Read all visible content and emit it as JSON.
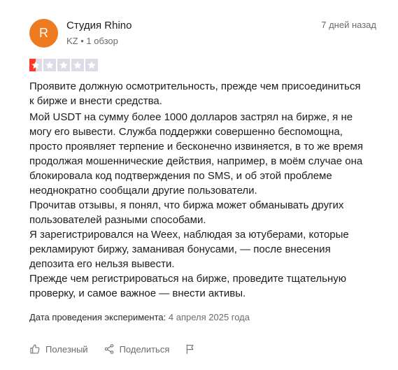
{
  "review": {
    "avatar_letter": "R",
    "avatar_color": "#ef7b20",
    "author_name": "Студия Rhino",
    "author_meta": "KZ • 1 обзор",
    "date": "7 дней назад",
    "rating": 1,
    "rating_max": 5,
    "star_color": "#ff3722",
    "title": "Проявите должную осмотрительность, прежде чем присоединиться к бирже и внести средства.",
    "body_paragraphs": [
      "Мой USDT на сумму более 1000 долларов застрял на бирже, я не могу его вывести. Служба поддержки совершенно беспомощна, просто проявляет терпение и бесконечно извиняется, в то же время продолжая мошеннические действия, например, в моём случае она блокировала код подтверждения по SMS, и об этой проблеме неоднократно сообщали другие пользователи.",
      "Прочитав отзывы, я понял, что биржа может обманывать других пользователей разными способами.",
      "Я зарегистрировался на Weex, наблюдая за ютуберами, которые рекламируют биржу, заманивая бонусами, — после внесения депозита его нельзя вывести.",
      "Прежде чем регистрироваться на бирже, проведите тщательную проверку, и самое важное — внести активы."
    ],
    "experience_label": "Дата проведения эксперимента:",
    "experience_date": "4 апреля 2025 года"
  },
  "actions": {
    "helpful_label": "Полезный",
    "helpful_icon": "thumbs-up-icon",
    "share_label": "Поделиться",
    "share_icon": "share-icon",
    "report_icon": "flag-icon"
  }
}
